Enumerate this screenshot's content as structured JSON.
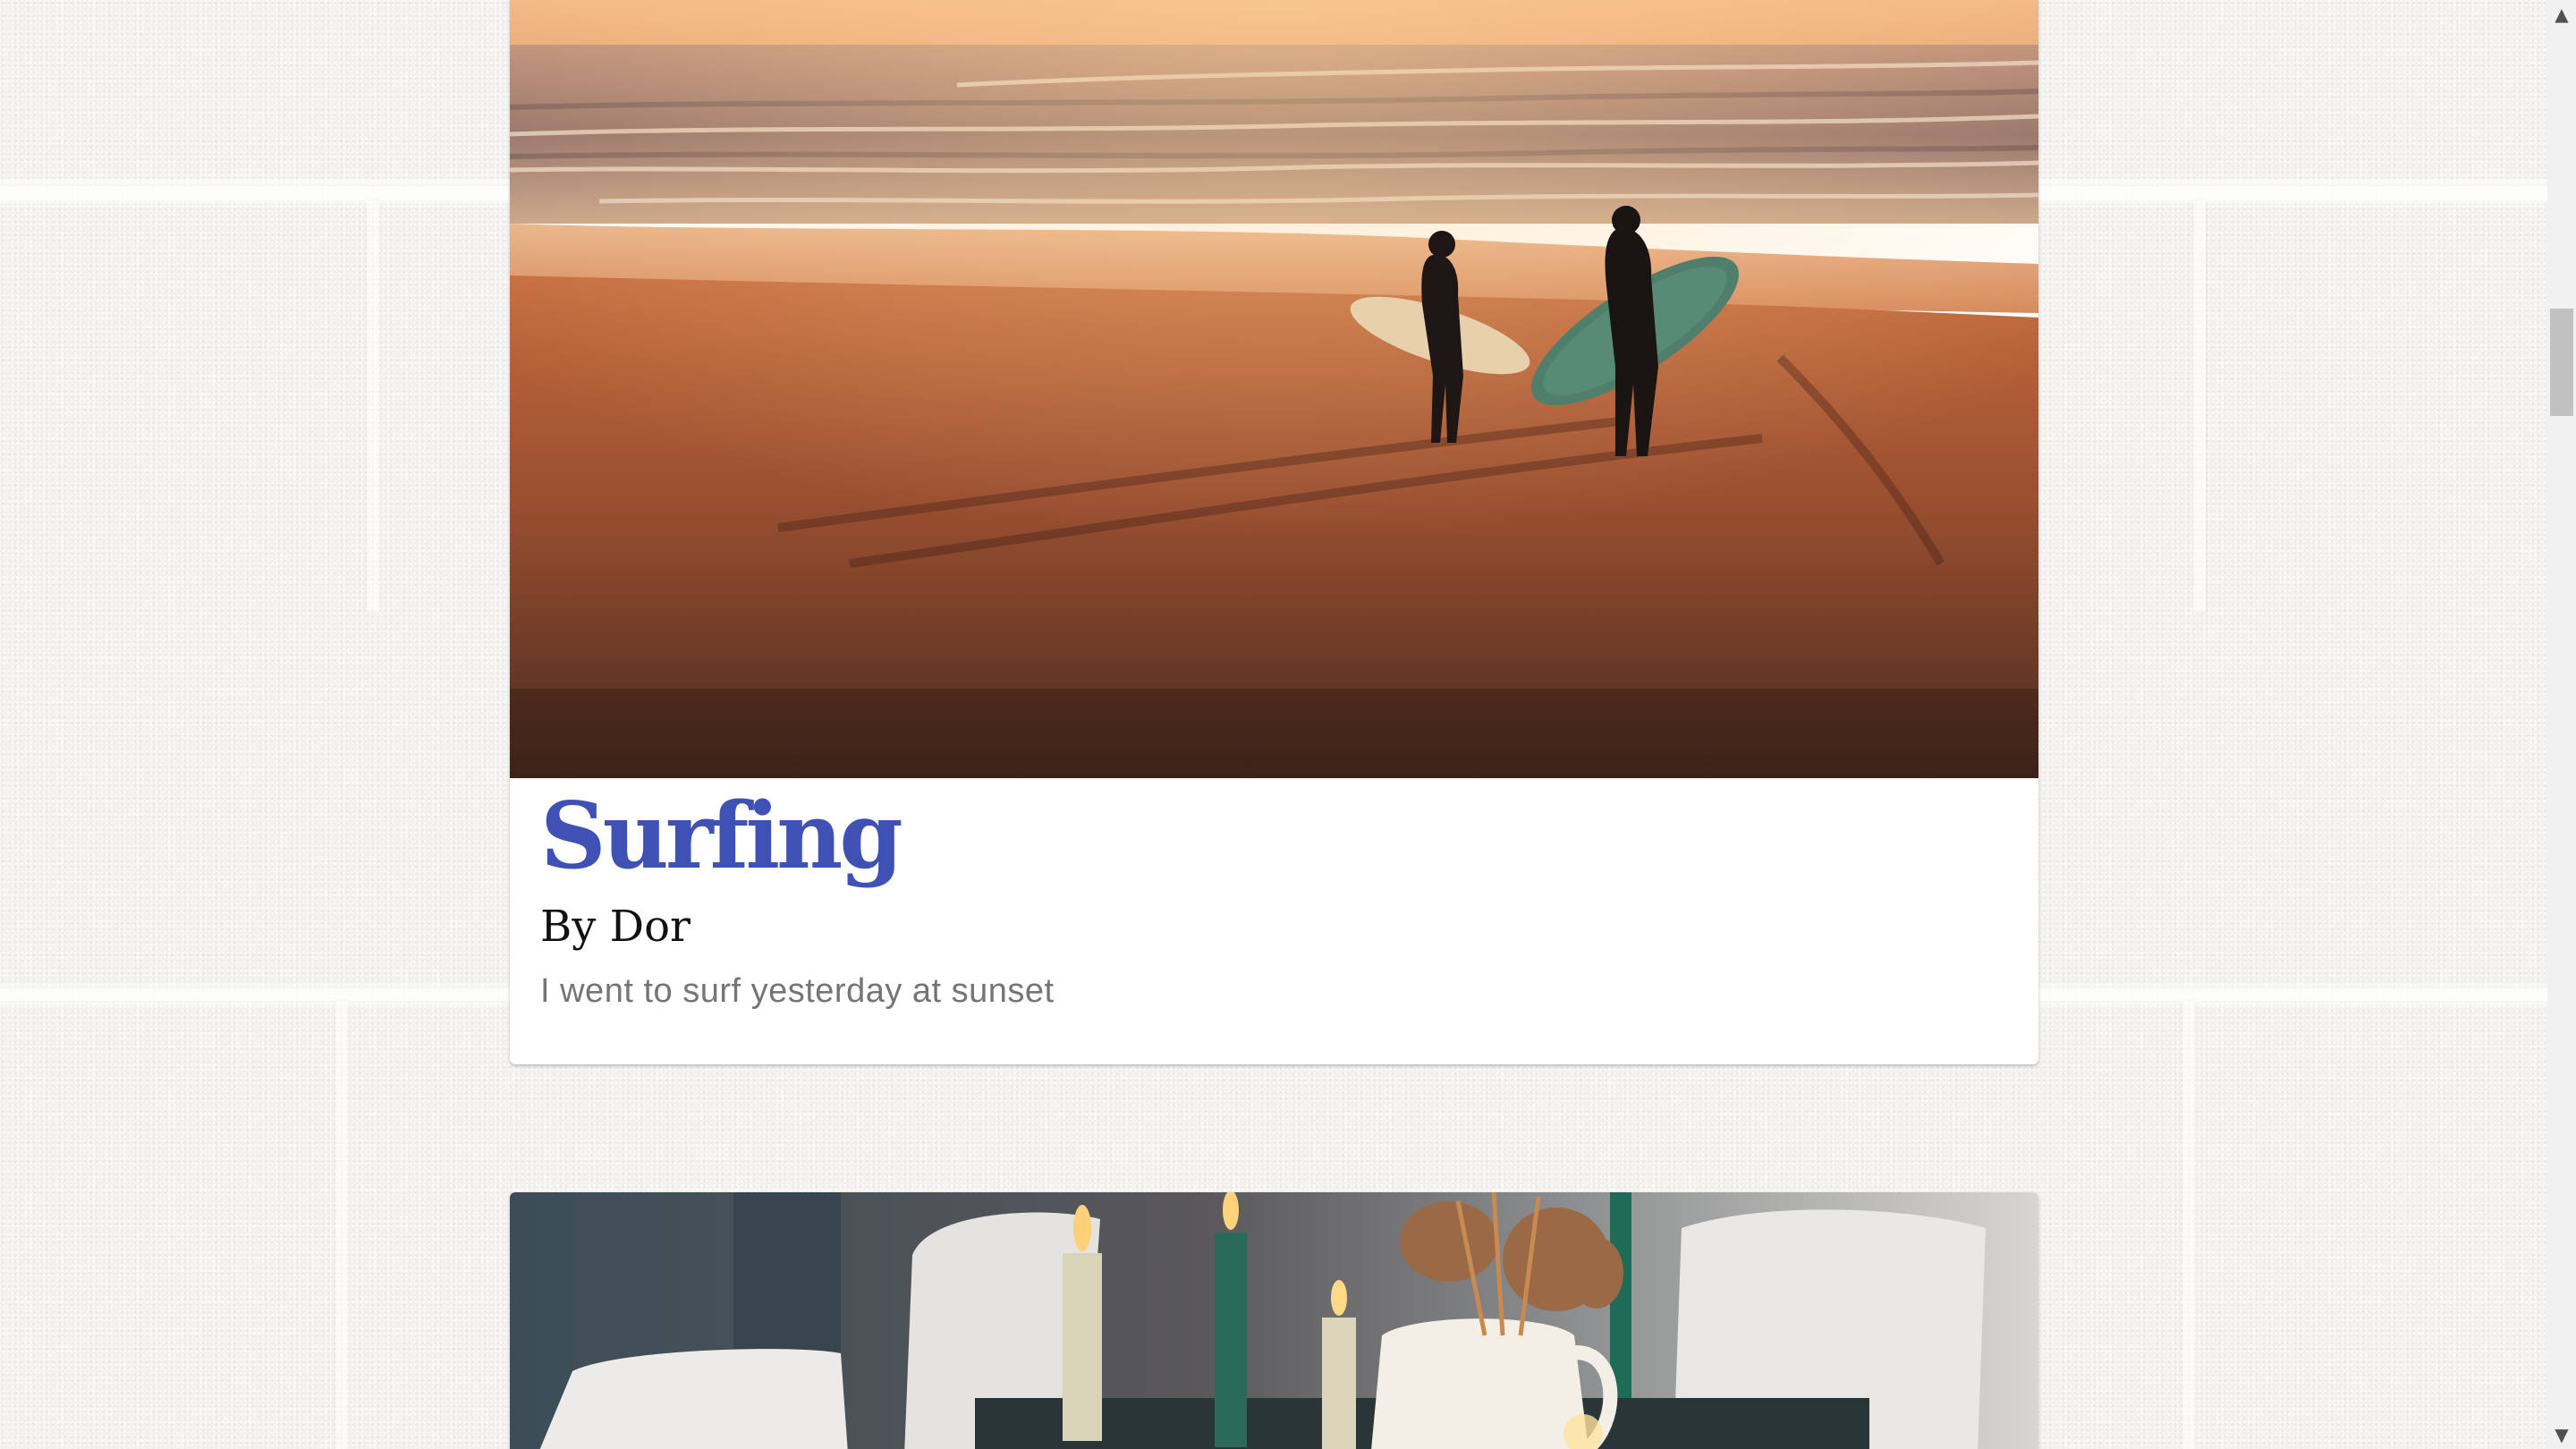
{
  "posts": [
    {
      "title": "Surfing",
      "author": "By Dor",
      "text": "I went to surf yesterday at sunset",
      "image_icon": "beach-sunset-surfers-photo"
    },
    {
      "image_icon": "candlelit-table-photo"
    }
  ],
  "scrollbar": {
    "up_icon": "▲",
    "down_icon": "▼"
  },
  "colors": {
    "title": "#3f51b5",
    "author": "#111111",
    "text": "#757575",
    "background": "#f3f2ef"
  }
}
